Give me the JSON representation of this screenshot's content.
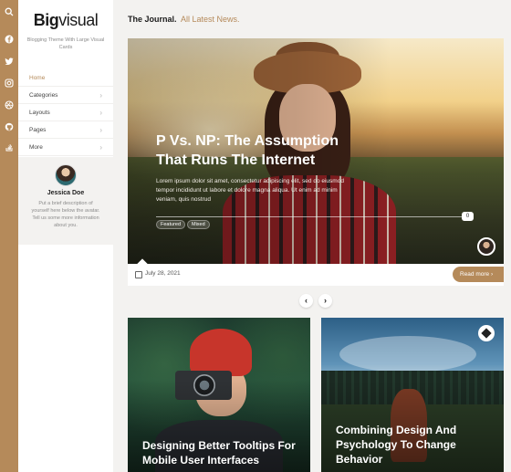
{
  "rail": {
    "icons": [
      {
        "name": "search-icon",
        "glyph": ""
      },
      {
        "name": "facebook-icon",
        "glyph": "f"
      },
      {
        "name": "twitter-icon",
        "glyph": ""
      },
      {
        "name": "instagram-icon",
        "glyph": ""
      },
      {
        "name": "dribbble-icon",
        "glyph": ""
      },
      {
        "name": "github-icon",
        "glyph": ""
      },
      {
        "name": "stackoverflow-icon",
        "glyph": ""
      }
    ]
  },
  "sidebar": {
    "brand_bold": "Big",
    "brand_rest": "visual",
    "tagline": "Blogging Theme With Large Visual Cards",
    "nav": [
      {
        "label": "Home",
        "active": true,
        "has_chevron": false
      },
      {
        "label": "Categories",
        "active": false,
        "has_chevron": true
      },
      {
        "label": "Layouts",
        "active": false,
        "has_chevron": true
      },
      {
        "label": "Pages",
        "active": false,
        "has_chevron": true
      },
      {
        "label": "More",
        "active": false,
        "has_chevron": true
      }
    ],
    "author": {
      "name": "Jessica Doe",
      "description": "Put a brief description of yourself here below the avatar. Tell us some more information about you."
    }
  },
  "header": {
    "title": "The Journal.",
    "subtitle": "All Latest News."
  },
  "hero": {
    "title": "P Vs. NP: The Assumption That Runs The Internet",
    "excerpt": "Lorem ipsum dolor sit amet, consectetur adipiscing elit, sed do eiusmod tempor incididunt ut labore et dolore magna aliqua. Ut enim ad minim veniam, quis nostrud",
    "comment_count": "0",
    "tags": [
      "Featured",
      "Mixed"
    ],
    "date": "July 28, 2021",
    "read_more": "Read more ›"
  },
  "pager": {
    "prev": "‹",
    "next": "›"
  },
  "cards": [
    {
      "title": "Designing Better Tooltips For Mobile User Interfaces"
    },
    {
      "title": "Combining Design And Psychology To Change Behavior"
    }
  ],
  "colors": {
    "accent": "#b58a5a",
    "rail": "#b58a5a",
    "background": "#f3f2f0"
  }
}
